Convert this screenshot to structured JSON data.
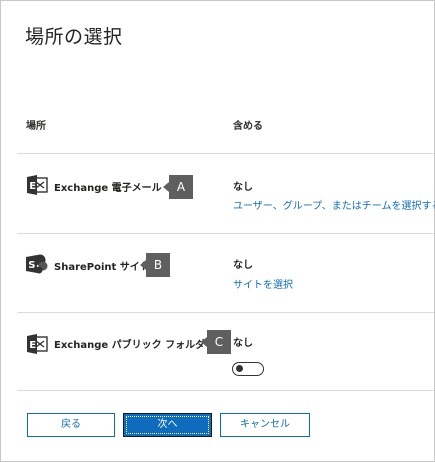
{
  "dialog": {
    "title": "場所の選択"
  },
  "columns": {
    "location": "場所",
    "include": "含める"
  },
  "rows": [
    {
      "name": "Exchange 電子メール",
      "icon": "exchange-icon",
      "callout": "A",
      "include_value": "なし",
      "link": "ユーザー、グループ、またはチームを選択する"
    },
    {
      "name": "SharePoint サイト",
      "icon": "sharepoint-icon",
      "callout": "B",
      "include_value": "なし",
      "link": "サイトを選択"
    },
    {
      "name": "Exchange パブリック フォルダー",
      "icon": "exchange-icon",
      "callout": "C",
      "include_value": "なし",
      "toggle_on": false
    }
  ],
  "buttons": {
    "back": "戻る",
    "next": "次へ",
    "cancel": "キャンセル"
  },
  "colors": {
    "accent": "#0f6cbd",
    "link": "#106ebe",
    "callout": "#5f5f5f",
    "exchange_icon": "#333333"
  }
}
